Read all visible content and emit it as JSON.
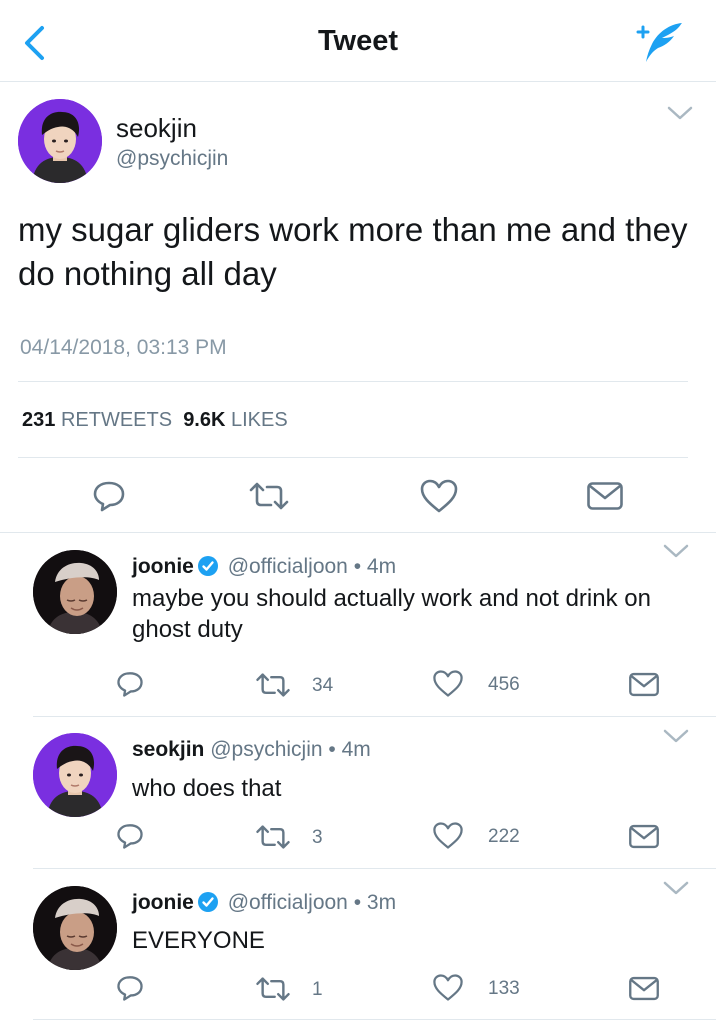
{
  "nav": {
    "title": "Tweet"
  },
  "tweet": {
    "name": "seokjin",
    "handle": "@psychicjin",
    "text": "my sugar gliders work more than me and they do nothing all day",
    "timestamp": "04/14/2018, 03:13 PM",
    "retweets_count": "231",
    "retweets_label": "RETWEETS",
    "likes_count": "9.6K",
    "likes_label": "LIKES"
  },
  "replies": [
    {
      "name": "joonie",
      "verified": true,
      "handle": "@officialjoon",
      "time": "• 4m",
      "text": "maybe you should actually work and not drink on ghost duty",
      "retweets": "34",
      "likes": "456"
    },
    {
      "name": "seokjin",
      "verified": false,
      "handle": "@psychicjin",
      "time": "• 4m",
      "text": "who does that",
      "retweets": "3",
      "likes": "222"
    },
    {
      "name": "joonie",
      "verified": true,
      "handle": "@officialjoon",
      "time": "• 3m",
      "text": "EVERYONE",
      "retweets": "1",
      "likes": "133"
    }
  ],
  "colors": {
    "accent": "#1da1f2",
    "secondary_text": "#657786",
    "divider": "#e1e8ed",
    "icon": "#657786"
  }
}
